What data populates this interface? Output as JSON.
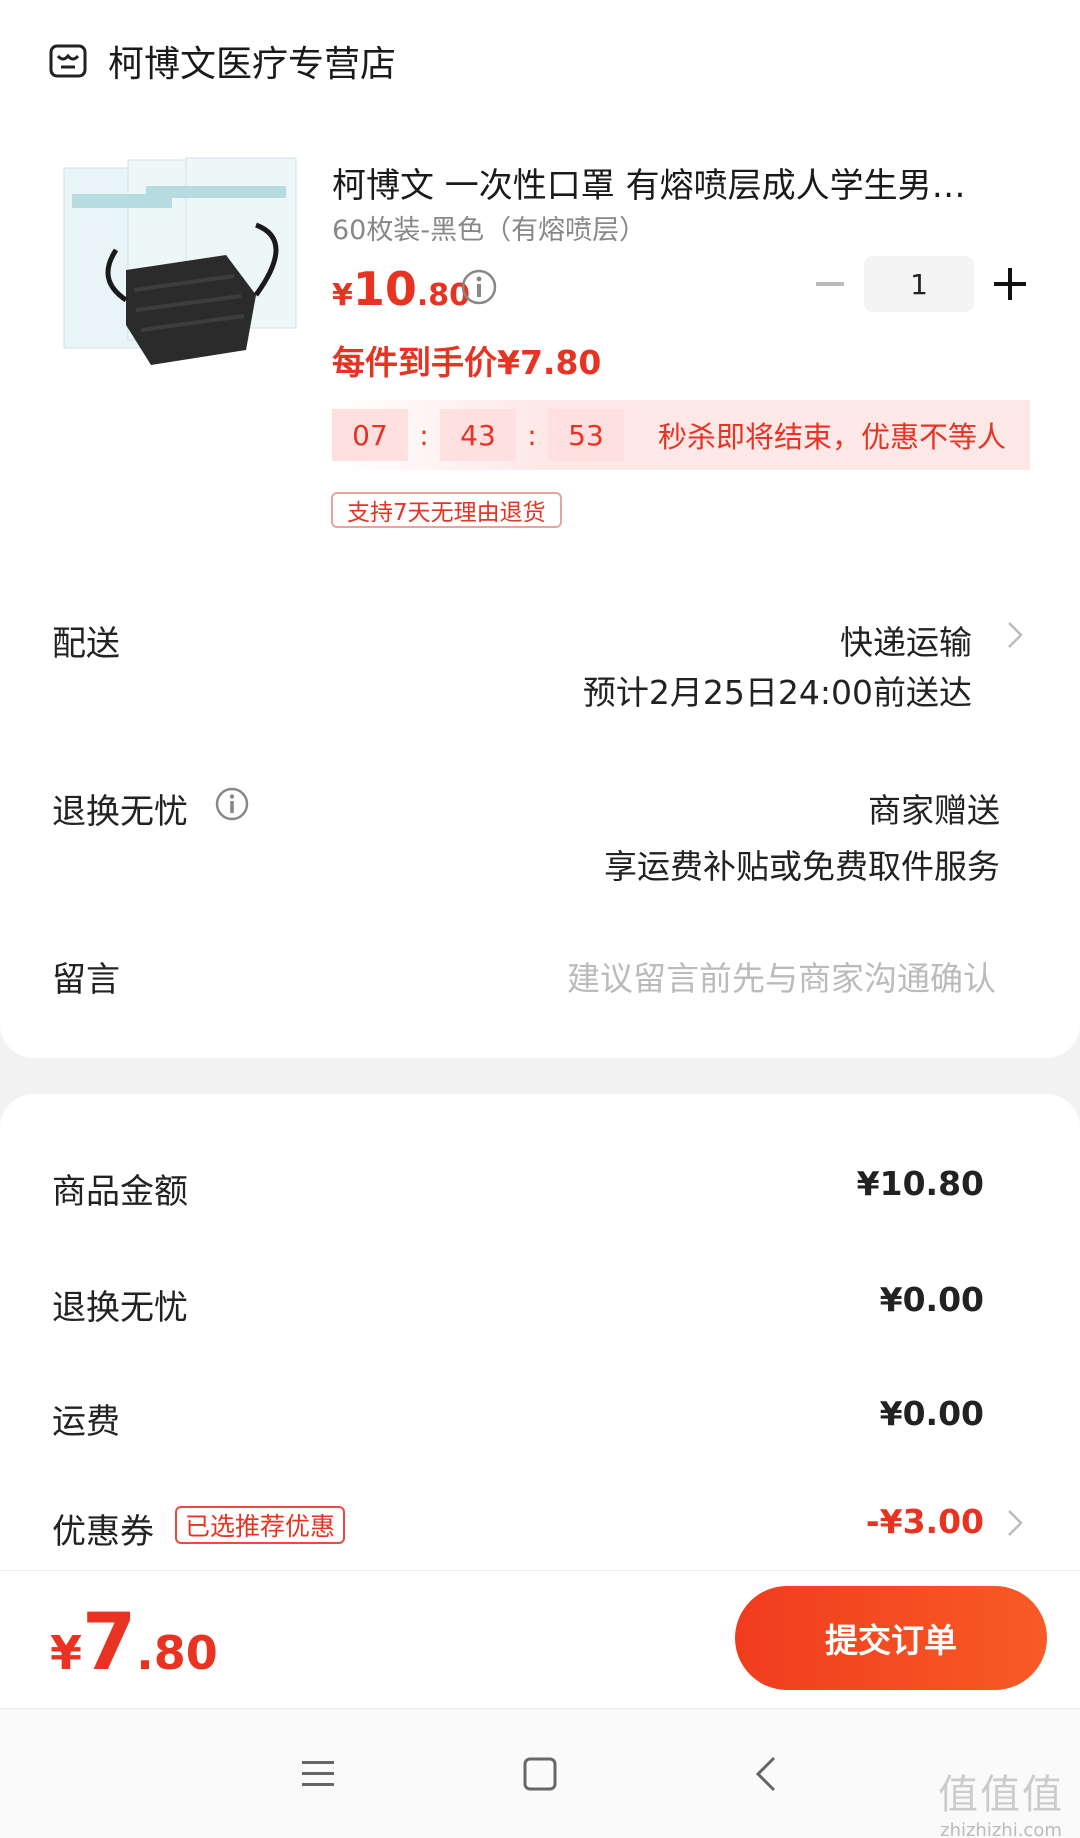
{
  "shop": {
    "name": "柯博文医疗专营店",
    "icon": "store-icon"
  },
  "product": {
    "title": "柯博文 一次性口罩 有熔喷层成人学生男…",
    "sku": "60枚装-黑色（有熔喷层）",
    "price_currency": "¥",
    "price_int": "10",
    "price_dec": ".80",
    "final_price_text": "每件到手价¥7.80",
    "quantity": "1",
    "thumbnail": "black-mask-product-image"
  },
  "flash_sale": {
    "hours": "07",
    "minutes": "43",
    "seconds": "53",
    "sep": ":",
    "text": "秒杀即将结束，优惠不等人"
  },
  "return_tag": "支持7天无理由退货",
  "delivery": {
    "label": "配送",
    "method": "快递运输",
    "estimate": "预计2月25日24:00前送达"
  },
  "return_worry_free": {
    "label": "退换无忧",
    "value_line1": "商家赠送",
    "value_line2": "享运费补贴或免费取件服务"
  },
  "message": {
    "label": "留言",
    "placeholder": "建议留言前先与商家沟通确认"
  },
  "summary": {
    "goods_label": "商品金额",
    "goods_value": "¥10.80",
    "return_label": "退换无忧",
    "return_value": "¥0.00",
    "shipping_label": "运费",
    "shipping_value": "¥0.00",
    "coupon_label": "优惠券",
    "coupon_badge": "已选推荐优惠",
    "coupon_value": "-¥3.00"
  },
  "footer": {
    "total_currency": "¥",
    "total_int": "7",
    "total_dec": ".80",
    "submit_label": "提交订单"
  },
  "watermark": {
    "big": "值值值",
    "small": "zhizhizhi.com"
  },
  "colors": {
    "accent": "#e83322",
    "button": "#f24a22",
    "muted": "#888888"
  }
}
